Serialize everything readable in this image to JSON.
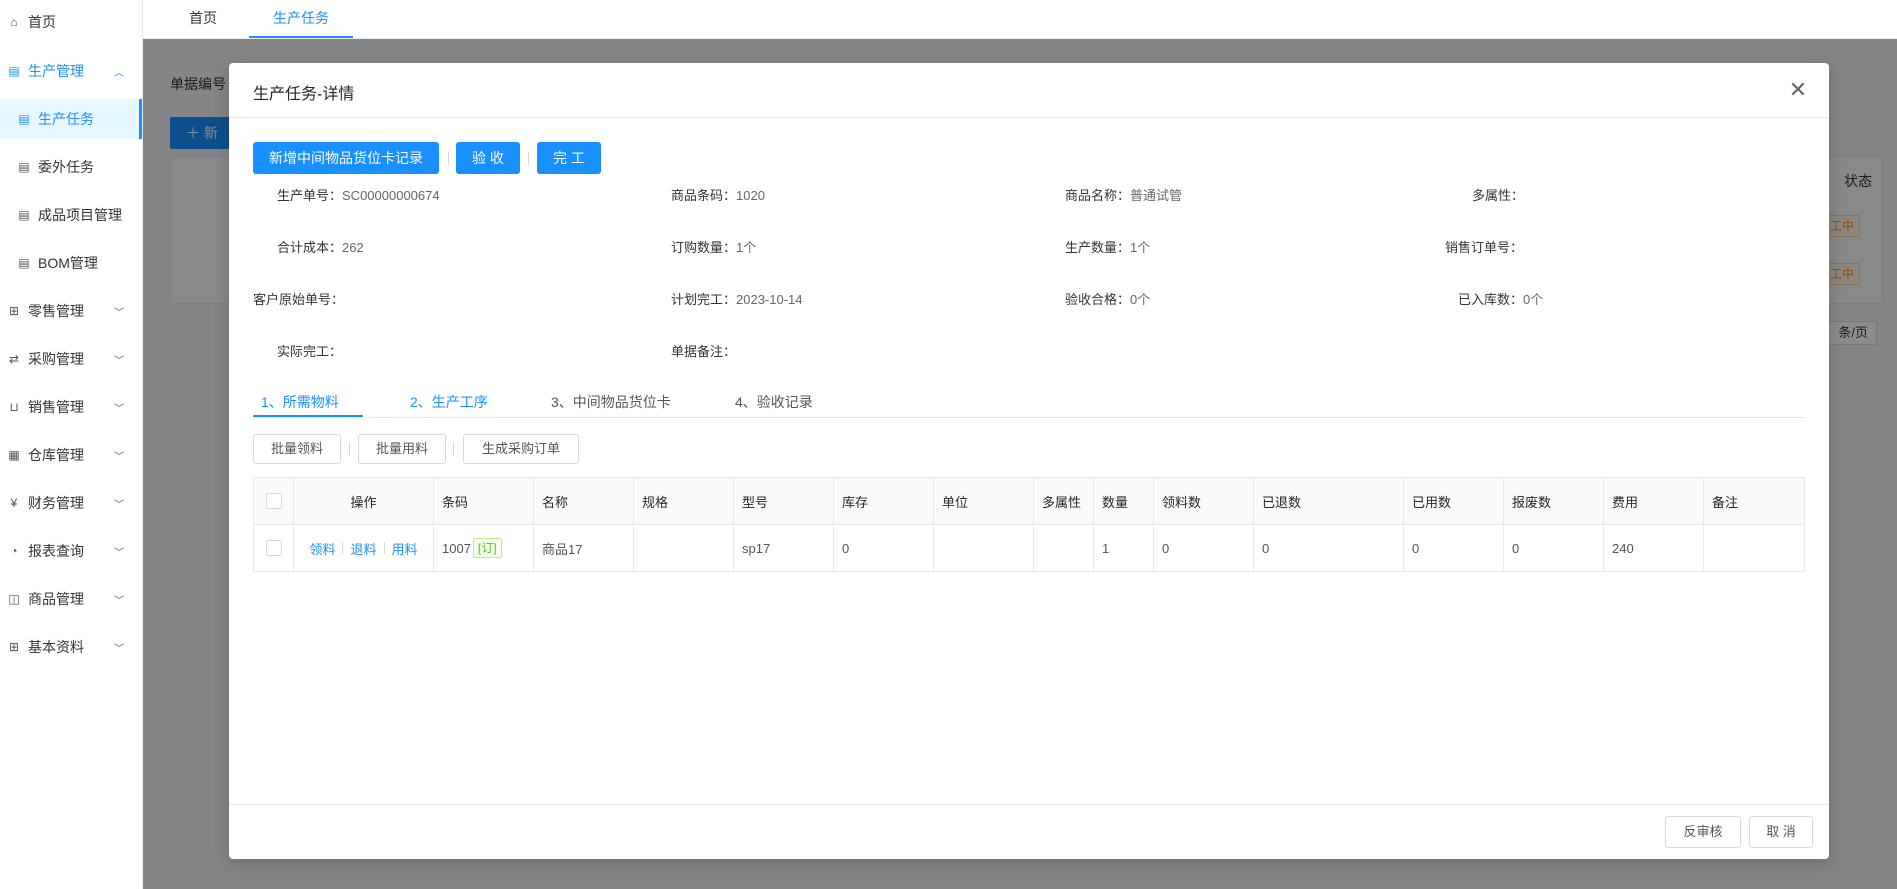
{
  "sidebar": {
    "items": [
      {
        "label": "首页",
        "icon": "home-icon"
      },
      {
        "label": "生产管理",
        "icon": "doc-icon"
      },
      {
        "label": "生产任务",
        "icon": "doc-icon"
      },
      {
        "label": "委外任务",
        "icon": "doc-icon"
      },
      {
        "label": "成品项目管理",
        "icon": "doc-icon"
      },
      {
        "label": "BOM管理",
        "icon": "doc-icon"
      },
      {
        "label": "零售管理",
        "icon": "gift-icon"
      },
      {
        "label": "采购管理",
        "icon": "swap-icon"
      },
      {
        "label": "销售管理",
        "icon": "cart-icon"
      },
      {
        "label": "仓库管理",
        "icon": "warehouse-icon"
      },
      {
        "label": "财务管理",
        "icon": "finance-icon"
      },
      {
        "label": "报表查询",
        "icon": "pie-icon"
      },
      {
        "label": "商品管理",
        "icon": "bag-icon"
      },
      {
        "label": "基本资料",
        "icon": "grid-icon"
      }
    ]
  },
  "top_tabs": [
    "首页",
    "生产任务"
  ],
  "background": {
    "filter_label": "单据编号",
    "new_button": "新增",
    "status_header": "状态",
    "status_badge": "加工中",
    "pager_text": "条/页"
  },
  "modal": {
    "title": "生产任务-详情",
    "actions": {
      "add_card": "新增中间物品货位卡记录",
      "accept": "验 收",
      "finish": "完 工"
    },
    "fields": {
      "prod_no_label": "生产单号：",
      "prod_no": "SC00000000674",
      "barcode_label": "商品条码：",
      "barcode": "1020",
      "goods_name_label": "商品名称：",
      "goods_name": "普通试管",
      "multi_attr_label": "多属性：",
      "multi_attr": "",
      "total_cost_label": "合计成本：",
      "total_cost": "262",
      "order_qty_label": "订购数量：",
      "order_qty": "1个",
      "prod_qty_label": "生产数量：",
      "prod_qty": "1个",
      "sales_order_label": "销售订单号：",
      "sales_order": "",
      "customer_no_label": "客户原始单号：",
      "customer_no": "",
      "plan_finish_label": "计划完工：",
      "plan_finish": "2023-10-14",
      "qualified_label": "验收合格：",
      "qualified": "0个",
      "stored_label": "已入库数：",
      "stored": "0个",
      "actual_finish_label": "实际完工：",
      "actual_finish": "",
      "remark_label": "单据备注：",
      "remark": ""
    },
    "tabs": [
      "1、所需物料",
      "2、生产工序",
      "3、中间物品货位卡",
      "4、验收记录"
    ],
    "table_actions": [
      "批量领料",
      "批量用料",
      "生成采购订单"
    ],
    "table": {
      "headers": [
        "操作",
        "条码",
        "名称",
        "规格",
        "型号",
        "库存",
        "单位",
        "多属性",
        "数量",
        "领料数",
        "已退数",
        "已用数",
        "报废数",
        "费用",
        "备注"
      ],
      "rows": [
        {
          "ops": [
            "领料",
            "退料",
            "用料"
          ],
          "barcode": "1007",
          "tag": "[订]",
          "name": "商品17",
          "spec": "",
          "model": "sp17",
          "stock": "0",
          "unit": "",
          "multi_attr": "",
          "qty": "1",
          "picked": "0",
          "returned": "0",
          "used": "0",
          "scrapped": "0",
          "cost": "240",
          "remark": ""
        }
      ]
    },
    "footer": {
      "reverse_audit": "反审核",
      "cancel": "取 消"
    }
  },
  "colors": {
    "accent": "#1890ff",
    "success": "#52c41a",
    "warning": "#fa8c16"
  }
}
